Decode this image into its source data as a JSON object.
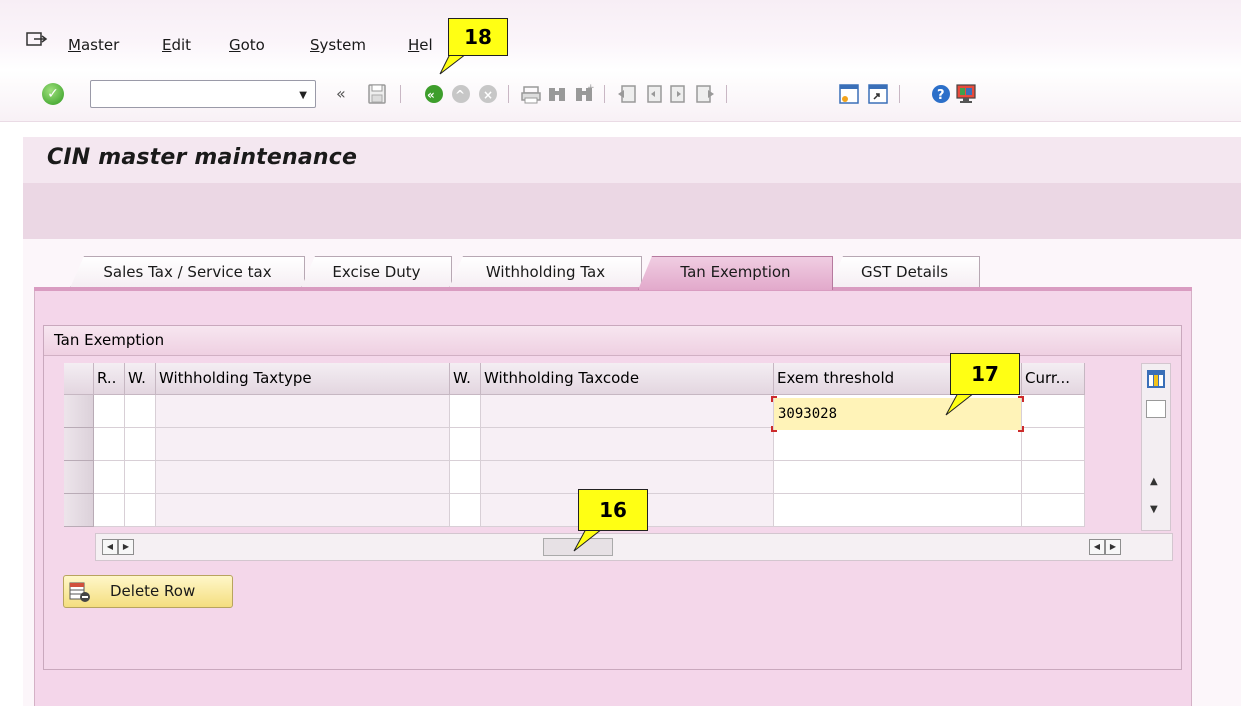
{
  "menu": {
    "items": [
      "Master",
      "Edit",
      "Goto",
      "System",
      "Hel"
    ]
  },
  "toolbar": {
    "command_field_value": "",
    "icons": [
      "enter-icon",
      "back-icon",
      "save-icon",
      "back-green-icon",
      "exit-icon",
      "cancel-icon",
      "print-icon",
      "find-icon",
      "find-next-icon",
      "first-page-icon",
      "previous-page-icon",
      "next-page-icon",
      "last-page-icon",
      "create-session-icon",
      "shortcut-icon",
      "help-icon",
      "customize-layout-icon"
    ]
  },
  "title": "CIN master maintenance",
  "tabs": [
    {
      "label": "Sales Tax / Service tax",
      "active": false
    },
    {
      "label": "Excise Duty",
      "active": false
    },
    {
      "label": "Withholding Tax",
      "active": false
    },
    {
      "label": "Tan Exemption",
      "active": true
    },
    {
      "label": "GST Details",
      "active": false
    }
  ],
  "group_title": "Tan Exemption",
  "table": {
    "headers": [
      "R..",
      "W.",
      "Withholding Taxtype",
      "W.",
      "Withholding Taxcode",
      "Exem threshold",
      "Curr..."
    ],
    "row_count": 4,
    "exem_threshold_value": "3093028"
  },
  "delete_row_label": "Delete Row",
  "callouts": [
    "18",
    "17",
    "16"
  ],
  "colors": {
    "accent_tab": "#e2a9cb",
    "panel": "#f4d6ea",
    "callout": "#ffff14"
  }
}
